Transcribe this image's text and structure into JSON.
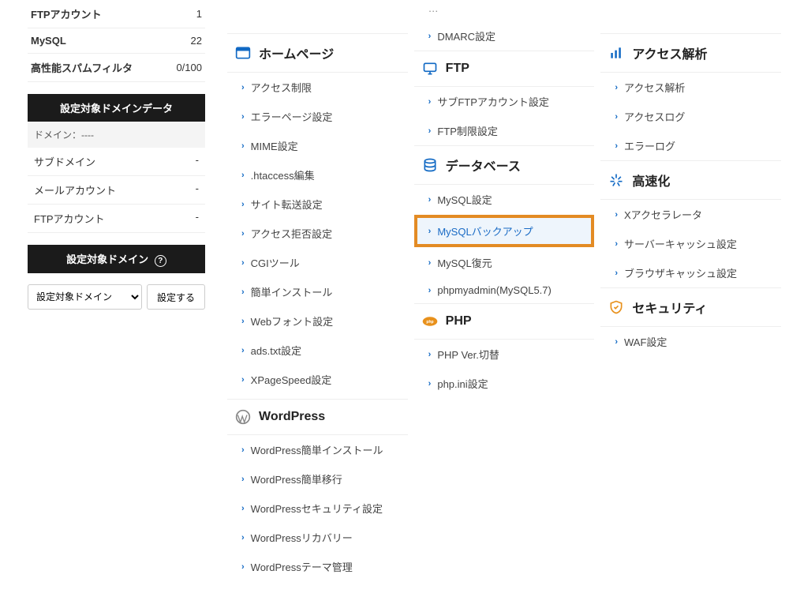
{
  "sidebar": {
    "stats": [
      {
        "label": "FTPアカウント",
        "val": "1"
      },
      {
        "label": "MySQL",
        "val": "22"
      },
      {
        "label": "高性能スパムフィルタ",
        "val": "0/100"
      }
    ],
    "domain_data_header": "設定対象ドメインデータ",
    "domain_label": "ドメイン：----",
    "rows": [
      {
        "label": "サブドメイン",
        "val": "-"
      },
      {
        "label": "メールアカウント",
        "val": "-"
      },
      {
        "label": "FTPアカウント",
        "val": "-"
      }
    ],
    "target_domain_header": "設定対象ドメイン",
    "select_placeholder": "設定対象ドメイン",
    "set_button": "設定する"
  },
  "orphan_items": [
    "DMARC設定"
  ],
  "sections": {
    "homepage": {
      "title": "ホームページ",
      "items": [
        "アクセス制限",
        "エラーページ設定",
        "MIME設定",
        ".htaccess編集",
        "サイト転送設定",
        "アクセス拒否設定",
        "CGIツール",
        "簡単インストール",
        "Webフォント設定",
        "ads.txt設定",
        "XPageSpeed設定"
      ]
    },
    "wordpress": {
      "title": "WordPress",
      "items": [
        "WordPress簡単インストール",
        "WordPress簡単移行",
        "WordPressセキュリティ設定",
        "WordPressリカバリー",
        "WordPressテーマ管理"
      ]
    },
    "ftp": {
      "title": "FTP",
      "items": [
        "サブFTPアカウント設定",
        "FTP制限設定"
      ]
    },
    "database": {
      "title": "データベース",
      "items": [
        "MySQL設定",
        "MySQLバックアップ",
        "MySQL復元",
        "phpmyadmin(MySQL5.7)"
      ],
      "highlight_index": 1
    },
    "php": {
      "title": "PHP",
      "items": [
        "PHP Ver.切替",
        "php.ini設定"
      ]
    },
    "access": {
      "title": "アクセス解析",
      "items": [
        "アクセス解析",
        "アクセスログ",
        "エラーログ"
      ]
    },
    "speed": {
      "title": "高速化",
      "items": [
        "Xアクセラレータ",
        "サーバーキャッシュ設定",
        "ブラウザキャッシュ設定"
      ]
    },
    "security": {
      "title": "セキュリティ",
      "items": [
        "WAF設定"
      ]
    }
  }
}
